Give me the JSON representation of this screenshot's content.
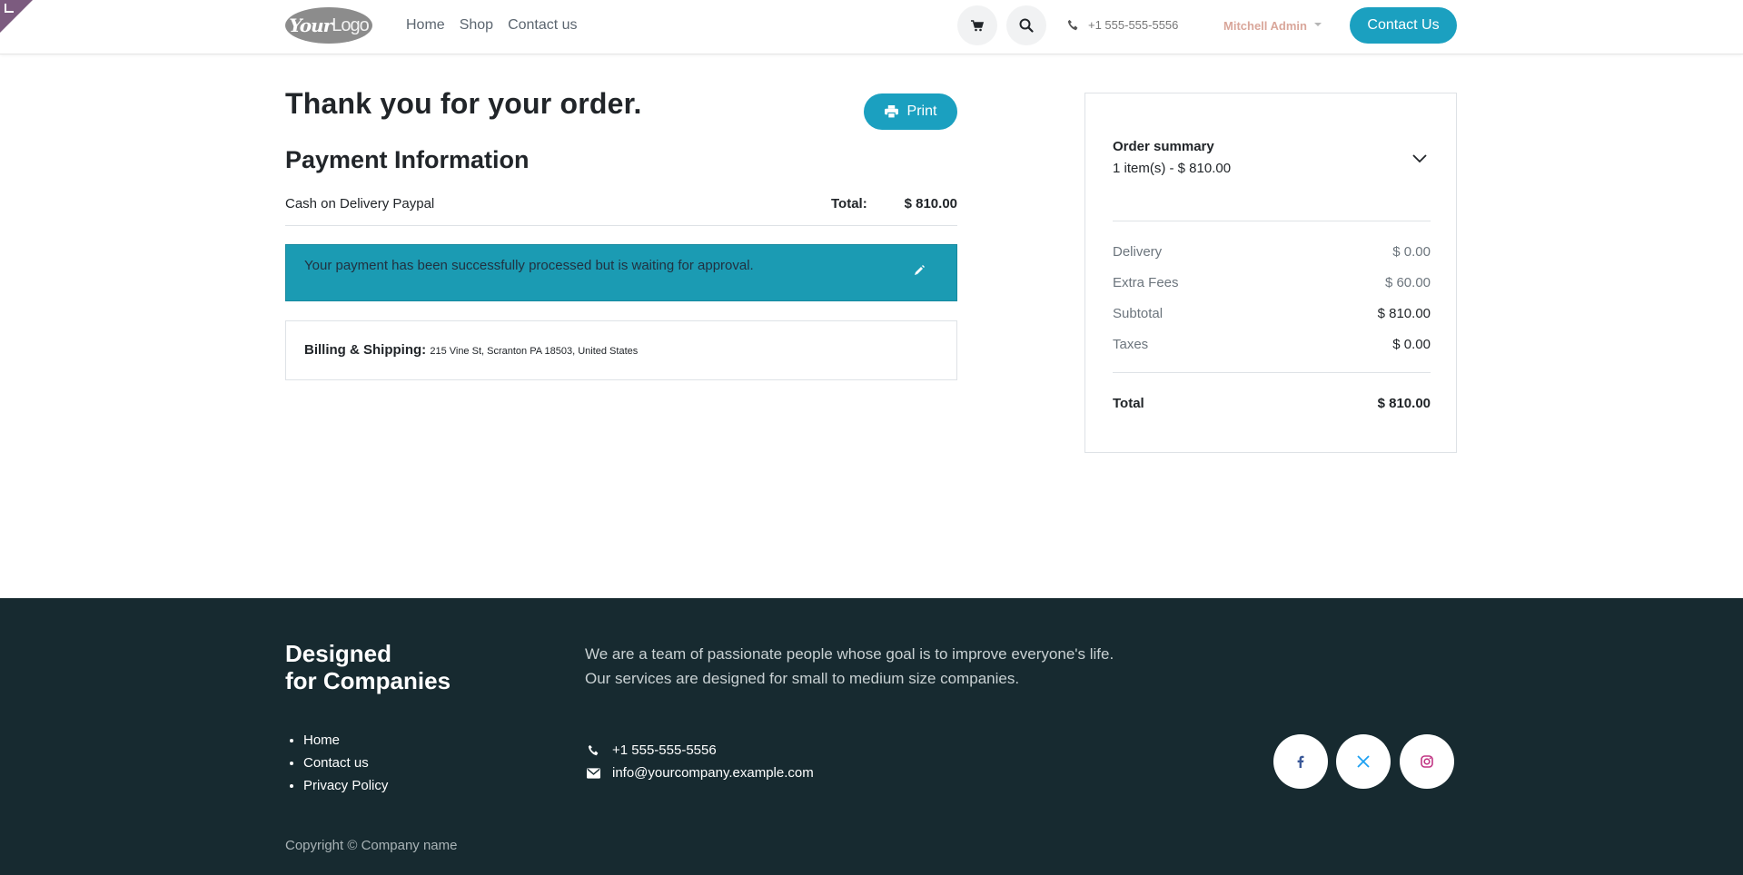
{
  "header": {
    "logo_text_bold": "Your",
    "logo_text_light": "Logo",
    "nav": [
      "Home",
      "Shop",
      "Contact us"
    ],
    "phone": "+1 555-555-5556",
    "user": "Mitchell Admin",
    "contact_button": "Contact Us"
  },
  "main": {
    "title": "Thank you for your order.",
    "print_label": "Print",
    "payment_heading": "Payment Information",
    "payment_method": "Cash on Delivery Paypal",
    "total_label": "Total:",
    "total_value": "$ 810.00",
    "alert_text": "Your payment has been successfully processed but is waiting for approval.",
    "billing_label": "Billing & Shipping:",
    "billing_address": "215 Vine St, Scranton PA 18503, United States"
  },
  "summary": {
    "title": "Order summary",
    "items_line": "1 item(s) -  $ 810.00",
    "rows": [
      {
        "label": "Delivery",
        "value": "$ 0.00"
      },
      {
        "label": "Extra Fees",
        "value": "$ 60.00"
      },
      {
        "label": "Subtotal",
        "value": "$ 810.00"
      },
      {
        "label": "Taxes",
        "value": "$ 0.00"
      }
    ],
    "total_label": "Total",
    "total_value": "$ 810.00"
  },
  "footer": {
    "title_line1": "Designed",
    "title_line2": "for Companies",
    "text_line1": "We are a team of passionate people whose goal is to improve everyone's life.",
    "text_line2": "Our services are designed for small to medium size companies.",
    "links": [
      "Home",
      "Contact us",
      "Privacy Policy"
    ],
    "phone": "+1 555-555-5556",
    "email": "info@yourcompany.example.com",
    "copyright": "Copyright © Company name"
  },
  "colors": {
    "accent": "#1ba0c0",
    "alert_bg": "#1b9bb3",
    "footer_bg": "#172a30",
    "user_name": "#d9a69a"
  },
  "icons": [
    "cart-icon",
    "search-icon",
    "phone-icon",
    "printer-icon",
    "pencil-icon",
    "chevron-down-icon",
    "envelope-icon",
    "facebook-icon",
    "x-icon",
    "instagram-icon"
  ]
}
